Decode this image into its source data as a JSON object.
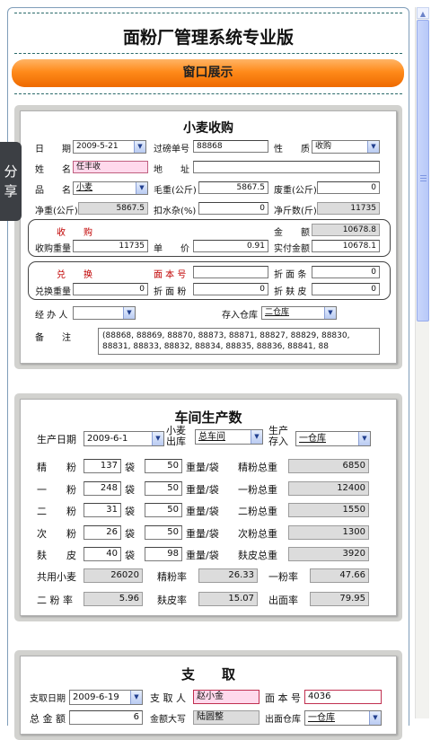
{
  "app_title": "面粉厂管理系统专业版",
  "banner": "窗口展示",
  "share": "分享",
  "wheat": {
    "title": "小麦收购",
    "date_label": "日　　期",
    "date_value": "2009-5-21",
    "weigh_no_label": "过磅单号",
    "weigh_no_value": "88868",
    "nature_label": "性　　质",
    "nature_value": "收购",
    "name_label": "姓　　名",
    "name_value": "任丰收",
    "address_label": "地　　址",
    "address_value": "",
    "variety_label": "品　　名",
    "variety_value": "小麦",
    "gross_label": "毛重(公斤)",
    "gross_value": "5867.5",
    "waste_label": "废重(公斤)",
    "waste_value": "0",
    "net_label": "净重(公斤)",
    "net_value": "5867.5",
    "deduct_label": "扣水杂(%)",
    "deduct_value": "0",
    "net_jin_label": "净斤数(斤)",
    "net_jin_value": "11735",
    "purchase_header": "收　　购",
    "amount_label": "金　　额",
    "amount_value": "10678.8",
    "purchase_weight_label": "收购重量",
    "purchase_weight_value": "11735",
    "unit_price_label": "单　　价",
    "unit_price_value": "0.91",
    "actual_amount_label": "实付金额",
    "actual_amount_value": "10678.1",
    "exchange_header": "兑　　换",
    "flour_book_label": "面 本 号",
    "flour_book_value": "",
    "discount_strip_label": "折 面 条",
    "discount_strip_value": "0",
    "exchange_weight_label": "兑换重量",
    "exchange_weight_value": "0",
    "discount_flour_label": "折 面 粉",
    "discount_flour_value": "0",
    "discount_bran_label": "折 麸 皮",
    "discount_bran_value": "0",
    "handler_label": "经 办 人",
    "handler_value": "",
    "warehouse_label": "存入仓库",
    "warehouse_value": "二仓库",
    "remark_label": "备　　注",
    "remark_value": "(88868, 88869, 88870, 88873, 88871, 88827, 88829, 88830, 88831, 88833, 88832, 88834, 88835, 88836, 88841, 88"
  },
  "production": {
    "title": "车间生产数",
    "date_label": "生产日期",
    "date_value": "2009-6-1",
    "wheat_out_label": "小麦\n出库",
    "wheat_out_value": "总车间",
    "store_in_label": "生产\n存入",
    "store_in_value": "一仓库",
    "bag_unit": "袋",
    "per_bag_label": "重量/袋",
    "rows": [
      {
        "label": "精　　粉",
        "bags": "137",
        "per_bag": "50",
        "total_label": "精粉总重",
        "total": "6850"
      },
      {
        "label": "一　　粉",
        "bags": "248",
        "per_bag": "50",
        "total_label": "一粉总重",
        "total": "12400"
      },
      {
        "label": "二　　粉",
        "bags": "31",
        "per_bag": "50",
        "total_label": "二粉总重",
        "total": "1550"
      },
      {
        "label": "次　　粉",
        "bags": "26",
        "per_bag": "50",
        "total_label": "次粉总重",
        "total": "1300"
      },
      {
        "label": "麸　　皮",
        "bags": "40",
        "per_bag": "98",
        "total_label": "麸皮总重",
        "total": "3920"
      }
    ],
    "wheat_used_label": "共用小麦",
    "wheat_used_value": "26020",
    "fine_rate_label": "精粉率",
    "fine_rate_value": "26.33",
    "first_rate_label": "一粉率",
    "first_rate_value": "47.66",
    "second_rate_label": "二 粉 率",
    "second_rate_value": "5.96",
    "bran_rate_label": "麸皮率",
    "bran_rate_value": "15.07",
    "yield_rate_label": "出面率",
    "yield_rate_value": "79.95"
  },
  "withdraw": {
    "title": "支　　取",
    "date_label": "支取日期",
    "date_value": "2009-6-19",
    "person_label": "支 取 人",
    "person_value": "赵小金",
    "book_label": "面 本 号",
    "book_value": "4036",
    "total_label": "总 金 额",
    "total_value": "6",
    "upper_label": "金额大写",
    "upper_value": "陆圆整",
    "out_label": "出面仓库",
    "out_value": "一仓库"
  }
}
